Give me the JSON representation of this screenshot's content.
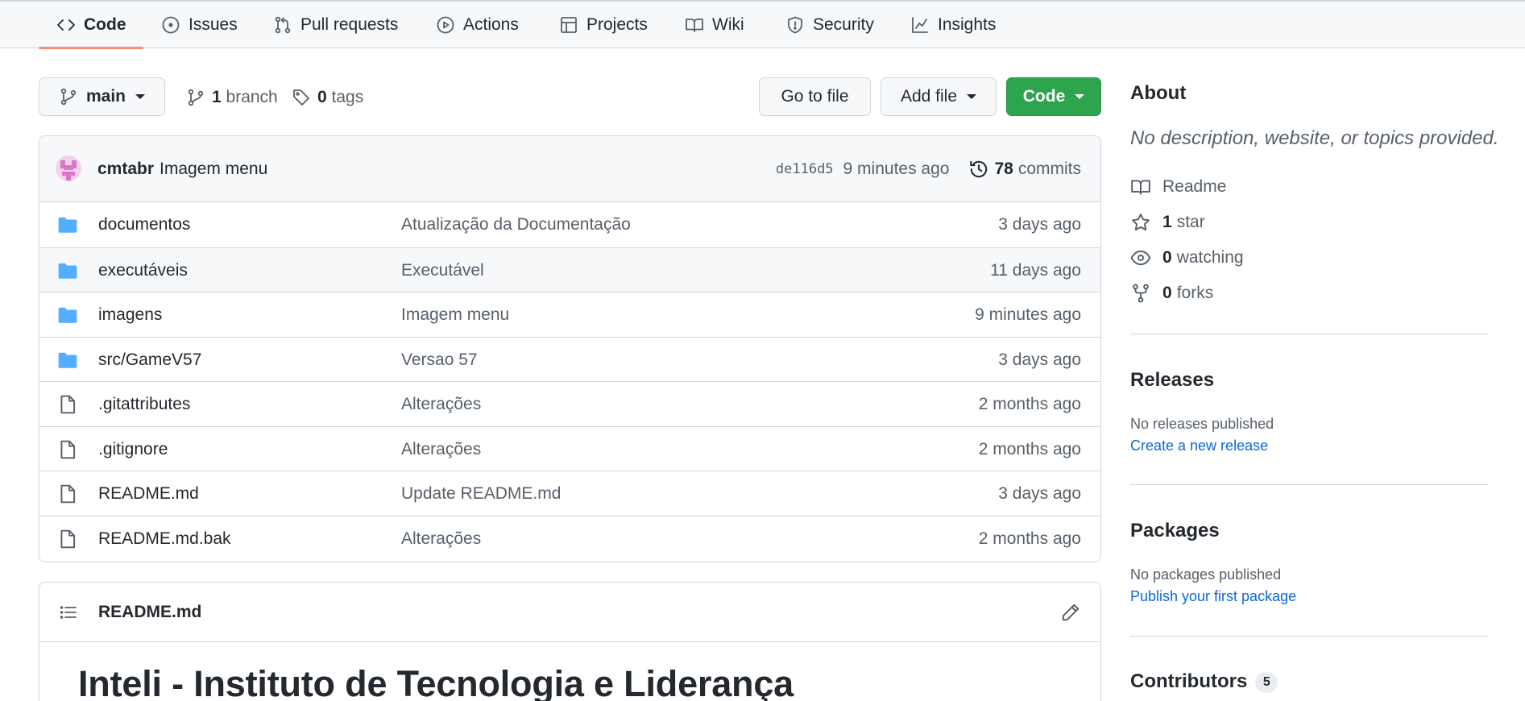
{
  "nav": {
    "tabs": [
      {
        "label": "Code",
        "icon": "code-icon",
        "active": true
      },
      {
        "label": "Issues",
        "icon": "issue-opened-icon"
      },
      {
        "label": "Pull requests",
        "icon": "git-pull-request-icon"
      },
      {
        "label": "Actions",
        "icon": "play-icon"
      },
      {
        "label": "Projects",
        "icon": "table-icon"
      },
      {
        "label": "Wiki",
        "icon": "book-icon"
      },
      {
        "label": "Security",
        "icon": "shield-icon"
      },
      {
        "label": "Insights",
        "icon": "graph-icon"
      }
    ]
  },
  "toolbar": {
    "branch_selector": "main",
    "branch_count": "1",
    "branch_label": "branch",
    "tag_count": "0",
    "tag_label": "tags",
    "go_to_file": "Go to file",
    "add_file": "Add file",
    "code_button": "Code"
  },
  "commit": {
    "author": "cmtabr",
    "message": "Imagem menu",
    "sha": "de116d5",
    "time": "9 minutes ago",
    "commit_count": "78",
    "commit_label": "commits"
  },
  "files": [
    {
      "type": "folder",
      "name": "documentos",
      "message": "Atualização da Documentação",
      "age": "3 days ago"
    },
    {
      "type": "folder",
      "name": "executáveis",
      "message": "Executável",
      "age": "11 days ago"
    },
    {
      "type": "folder",
      "name": "imagens",
      "message": "Imagem menu",
      "age": "9 minutes ago"
    },
    {
      "type": "folder",
      "name": "src/GameV57",
      "message": "Versao 57",
      "age": "3 days ago"
    },
    {
      "type": "file",
      "name": ".gitattributes",
      "message": "Alterações",
      "age": "2 months ago"
    },
    {
      "type": "file",
      "name": ".gitignore",
      "message": "Alterações",
      "age": "2 months ago"
    },
    {
      "type": "file",
      "name": "README.md",
      "message": "Update README.md",
      "age": "3 days ago"
    },
    {
      "type": "file",
      "name": "README.md.bak",
      "message": "Alterações",
      "age": "2 months ago"
    }
  ],
  "readme": {
    "filename": "README.md",
    "heading": "Inteli - Instituto de Tecnologia e Liderança"
  },
  "sidebar": {
    "about_title": "About",
    "about_description": "No description, website, or topics provided.",
    "readme_label": "Readme",
    "stars_count": "1",
    "stars_label": "star",
    "watching_count": "0",
    "watching_label": "watching",
    "forks_count": "0",
    "forks_label": "forks",
    "releases_title": "Releases",
    "releases_note": "No releases published",
    "releases_link": "Create a new release",
    "packages_title": "Packages",
    "packages_note": "No packages published",
    "packages_link": "Publish your first package",
    "contributors_title": "Contributors",
    "contributors_count": "5"
  },
  "colors": {
    "accent_green": "#2da44e",
    "link_blue": "#0969da",
    "folder_blue": "#54aeff",
    "tab_underline": "#fd8c73"
  }
}
